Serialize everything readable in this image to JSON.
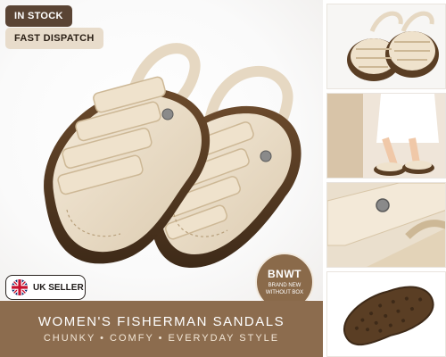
{
  "badges": {
    "stock": "IN STOCK",
    "dispatch": "FAST DISPATCH",
    "uk_seller": "UK SELLER"
  },
  "bnwt": {
    "title": "BNWT",
    "subtitle": "BRAND NEW WITHOUT BOX"
  },
  "banner": {
    "title": "WOMEN'S FISHERMAN SANDALS",
    "subtitle": "CHUNKY • COMFY • EVERYDAY STYLE"
  },
  "colors": {
    "accent_brown": "#8c6c4e",
    "dark_brown": "#5a4434",
    "cream": "#e8dccb",
    "sole_brown": "#5a3e24"
  },
  "thumbnails": [
    {
      "icon": "sandal-pair-top-view"
    },
    {
      "icon": "sandals-worn-model"
    },
    {
      "icon": "sandal-strap-closeup"
    },
    {
      "icon": "sandal-sole-bottom"
    }
  ]
}
